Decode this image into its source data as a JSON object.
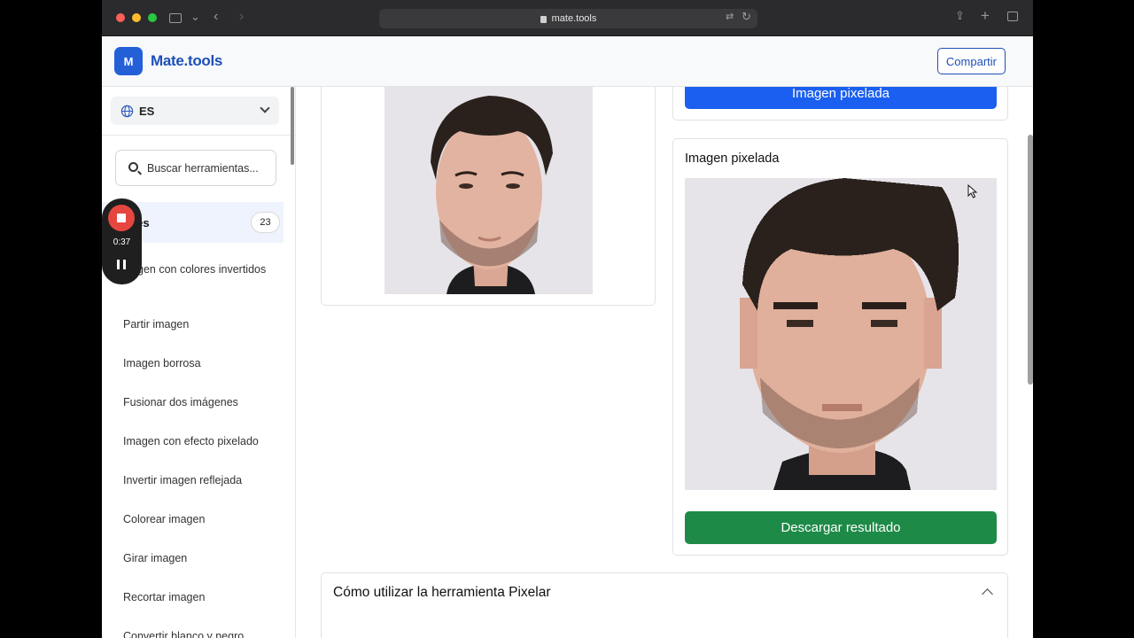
{
  "browser": {
    "url": "mate.tools",
    "traffic_light_colors": [
      "#fe5f57",
      "#febc2e",
      "#28c840"
    ]
  },
  "header": {
    "logo_letter": "M",
    "brand": "Mate.tools",
    "share_label": "Compartir"
  },
  "sidebar": {
    "language": "ES",
    "search_placeholder": "Buscar herramientas...",
    "category": {
      "label": "enes",
      "count": "23"
    },
    "items": [
      "gen con colores invertidos",
      "Partir imagen",
      "Imagen borrosa",
      "Fusionar dos imágenes",
      "Imagen con efecto pixelado",
      "Invertir imagen reflejada",
      "Colorear imagen",
      "Girar imagen",
      "Recortar imagen",
      "Convertir blanco y negro"
    ]
  },
  "recording": {
    "time": "0:37"
  },
  "main": {
    "top_button": "Imagen pixelada",
    "result_title": "Imagen pixelada",
    "download_label": "Descargar resultado",
    "howto_title": "Cómo utilizar la herramienta Pixelar"
  },
  "colors": {
    "primary": "#1a5ff0",
    "success": "#1e8a47",
    "brand": "#1d4fb8"
  }
}
